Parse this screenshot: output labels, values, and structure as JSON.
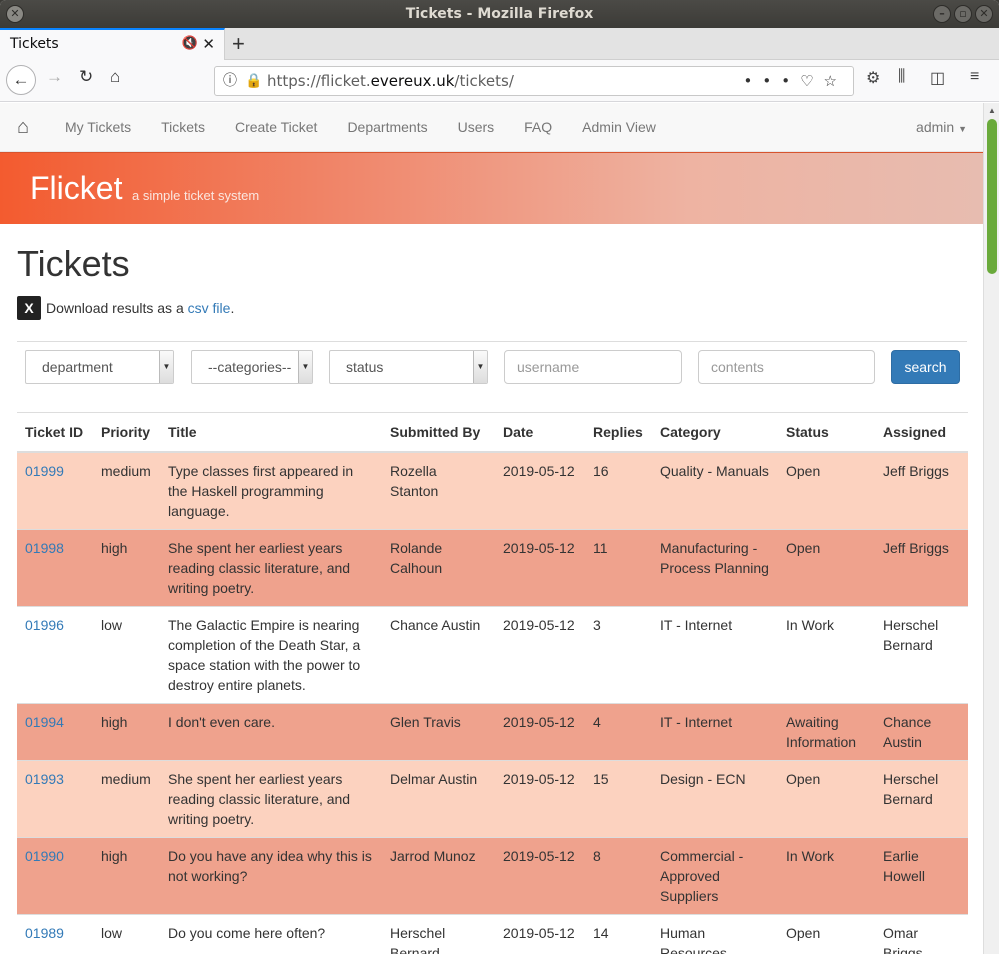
{
  "window": {
    "title": "Tickets - Mozilla Firefox"
  },
  "browser": {
    "tab_title": "Tickets",
    "url_prefix": "https://flicket.",
    "url_domain": "evereux.uk",
    "url_path": "/tickets/"
  },
  "nav": {
    "items": [
      "My Tickets",
      "Tickets",
      "Create Ticket",
      "Departments",
      "Users",
      "FAQ",
      "Admin View"
    ],
    "user": "admin"
  },
  "banner": {
    "brand": "Flicket",
    "tagline": "a simple ticket system"
  },
  "page": {
    "heading": "Tickets",
    "download_prefix": "Download results as a ",
    "download_link": "csv file",
    "download_suffix": "."
  },
  "filters": {
    "department": "department",
    "categories": "--categories--",
    "status": "status",
    "username_placeholder": "username",
    "contents_placeholder": "contents",
    "search_label": "search"
  },
  "table": {
    "headers": [
      "Ticket ID",
      "Priority",
      "Title",
      "Submitted By",
      "Date",
      "Replies",
      "Category",
      "Status",
      "Assigned"
    ],
    "rows": [
      {
        "id": "01999",
        "priority": "medium",
        "title": "Type classes first appeared in the Haskell programming language.",
        "submitted_by": "Rozella Stanton",
        "date": "2019-05-12",
        "replies": "16",
        "category": "Quality - Manuals",
        "status": "Open",
        "assigned": "Jeff Briggs"
      },
      {
        "id": "01998",
        "priority": "high",
        "title": "She spent her earliest years reading classic literature, and writing poetry.",
        "submitted_by": "Rolande Calhoun",
        "date": "2019-05-12",
        "replies": "11",
        "category": "Manufacturing - Process Planning",
        "status": "Open",
        "assigned": "Jeff Briggs"
      },
      {
        "id": "01996",
        "priority": "low",
        "title": "The Galactic Empire is nearing completion of the Death Star, a space station with the power to destroy entire planets.",
        "submitted_by": "Chance Austin",
        "date": "2019-05-12",
        "replies": "3",
        "category": "IT - Internet",
        "status": "In Work",
        "assigned": "Herschel Bernard"
      },
      {
        "id": "01994",
        "priority": "high",
        "title": "I don't even care.",
        "submitted_by": "Glen Travis",
        "date": "2019-05-12",
        "replies": "4",
        "category": "IT - Internet",
        "status": "Awaiting Information",
        "assigned": "Chance Austin"
      },
      {
        "id": "01993",
        "priority": "medium",
        "title": "She spent her earliest years reading classic literature, and writing poetry.",
        "submitted_by": "Delmar Austin",
        "date": "2019-05-12",
        "replies": "15",
        "category": "Design - ECN",
        "status": "Open",
        "assigned": "Herschel Bernard"
      },
      {
        "id": "01990",
        "priority": "high",
        "title": "Do you have any idea why this is not working?",
        "submitted_by": "Jarrod Munoz",
        "date": "2019-05-12",
        "replies": "8",
        "category": "Commercial - Approved Suppliers",
        "status": "In Work",
        "assigned": "Earlie Howell"
      },
      {
        "id": "01989",
        "priority": "low",
        "title": "Do you come here often?",
        "submitted_by": "Herschel Bernard",
        "date": "2019-05-12",
        "replies": "14",
        "category": "Human Resources",
        "status": "Open",
        "assigned": "Omar Briggs"
      }
    ]
  },
  "colors": {
    "medium_row": "#fcd2bf",
    "high_row": "#efa28d",
    "low_row": "#ffffff",
    "link": "#337ab7",
    "banner_start": "#f35b2f"
  }
}
